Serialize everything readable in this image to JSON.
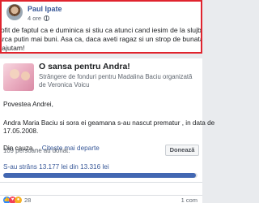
{
  "post": {
    "author": "Paul Ipate",
    "time": "4 ore",
    "text_lines": [
      "rofit de faptul ca e duminica si stiu ca atunci cand iesim de la slujba suntem",
      "arca putin mai buni. Asa ca, daca aveti ragaz si un strop de bunatate, hai sa",
      "i ajutam!"
    ]
  },
  "fundraiser": {
    "title": "O sansa pentru Andra!",
    "subtitle": "Strângere de fonduri pentru Madalina Baciu organizată de Veronica Voicu",
    "greeting": "Povestea Andrei,",
    "body_lines": [
      "Andra Maria Baciu si sora ei geamana s-au nascut prematur , in data de",
      "17.05.2008."
    ],
    "more_prefix": "Din cauza ... ",
    "more_link": "Citește mai departe",
    "raised_text": "S-au strâns 13.177 lei din 13.316 lei",
    "progress": 0.9896,
    "donors_text": "109 persoane au donat.",
    "donate_label": "Donează"
  },
  "footer": {
    "reaction_icons": [
      "like-icon",
      "love-icon",
      "wow-icon"
    ],
    "reaction_count": "28",
    "comments_text": "1 com"
  },
  "colors": {
    "highlight": "#e0242e",
    "link": "#385898",
    "progress": "#4267b2"
  }
}
